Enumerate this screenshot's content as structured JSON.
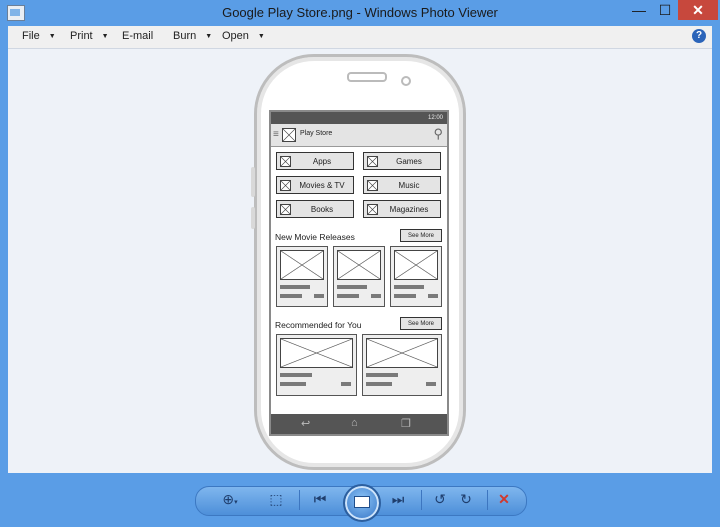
{
  "window": {
    "title": "Google Play Store.png - Windows Photo Viewer",
    "minimize": "—",
    "maximize": "☐",
    "close": "✕"
  },
  "menu": {
    "items": [
      "File",
      "Print",
      "E-mail",
      "Burn",
      "Open"
    ],
    "help": "?"
  },
  "mockup": {
    "status_time": "12:00",
    "app_title": "Play Store",
    "categories": [
      "Apps",
      "Games",
      "Movies & TV",
      "Music",
      "Books",
      "Magazines"
    ],
    "section_new_movies": "New Movie Releases",
    "section_recommended": "Recommended for You",
    "see_more": "See More",
    "nav_icons": [
      "back-icon",
      "home-icon",
      "recent-apps-icon"
    ]
  },
  "toolbar": {
    "icons": [
      "zoom-icon",
      "actual-size-icon",
      "previous-icon",
      "slideshow-icon",
      "next-icon",
      "rotate-left-icon",
      "rotate-right-icon",
      "delete-icon"
    ]
  },
  "colors": {
    "chrome": "#5a9de6",
    "close": "#c7483d",
    "viewer_bg": "#eef2f8"
  }
}
